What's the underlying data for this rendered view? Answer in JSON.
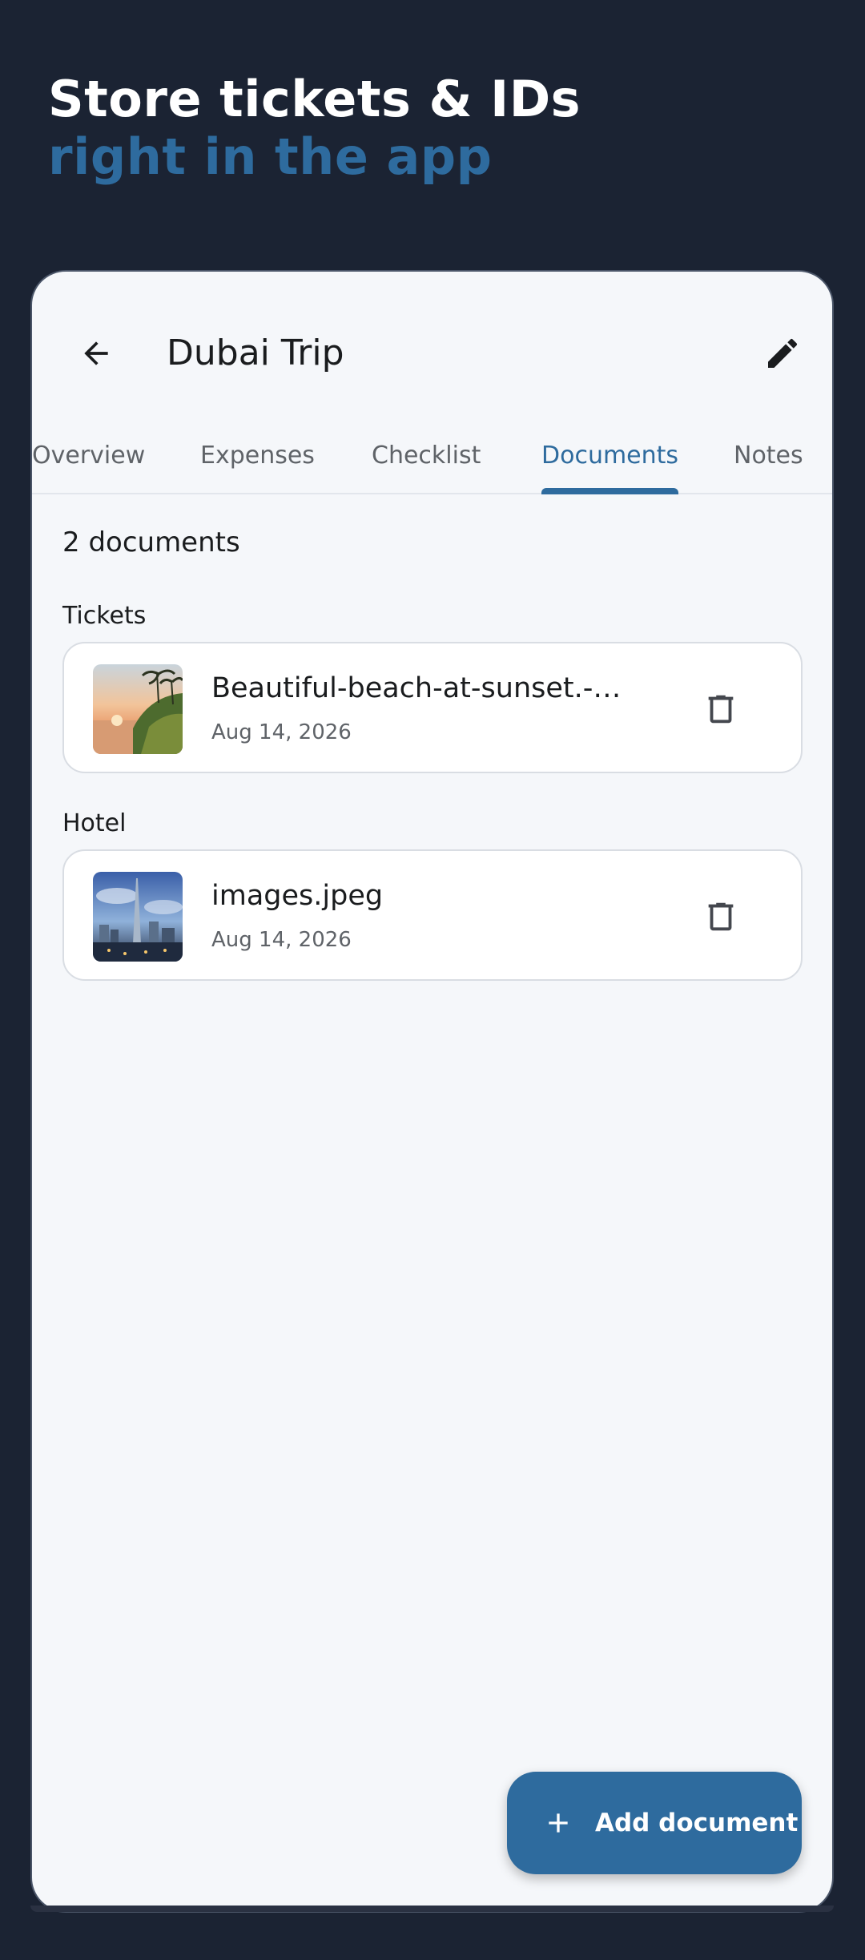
{
  "promo": {
    "line1": "Store tickets & IDs",
    "line2": "right in the app"
  },
  "appbar": {
    "title": "Dubai Trip",
    "back_icon": "arrow-back-icon",
    "edit_icon": "pencil-icon"
  },
  "tabs": [
    {
      "label": "Overview",
      "active": false
    },
    {
      "label": "Expenses",
      "active": false
    },
    {
      "label": "Checklist",
      "active": false
    },
    {
      "label": "Documents",
      "active": true
    },
    {
      "label": "Notes",
      "active": false
    }
  ],
  "documents": {
    "count_label": "2 documents",
    "groups": [
      {
        "label": "Tickets",
        "items": [
          {
            "name": "Beautiful-beach-at-sunset.-Col…",
            "date": "Aug 14, 2026",
            "thumbnail": "beach-sunset-image"
          }
        ]
      },
      {
        "label": "Hotel",
        "items": [
          {
            "name": "images.jpeg",
            "date": "Aug 14, 2026",
            "thumbnail": "city-skyline-image"
          }
        ]
      }
    ]
  },
  "fab": {
    "label": "Add document",
    "icon": "plus-icon"
  },
  "colors": {
    "background": "#1b2333",
    "accent": "#2e6b9e",
    "surface": "#f5f7fa"
  }
}
